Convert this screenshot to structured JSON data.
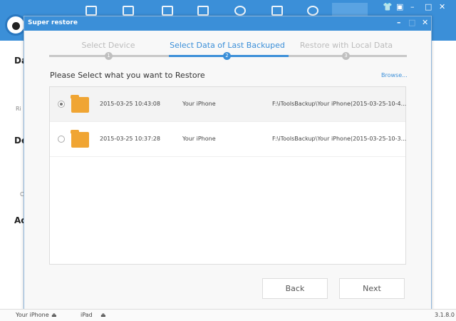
{
  "app": {
    "background_fragments": [
      "Da",
      "Ri",
      "De",
      "C",
      "Ac"
    ],
    "version": "3.1.8.0",
    "status_devices": [
      {
        "name": "Your iPhone"
      },
      {
        "name": "iPad"
      }
    ]
  },
  "dialog": {
    "title": "Super restore",
    "steps": [
      {
        "number": "1",
        "label": "Select Device",
        "active": false
      },
      {
        "number": "2",
        "label": "Select Data of Last Backuped",
        "active": true
      },
      {
        "number": "3",
        "label": "Restore with Local Data",
        "active": false
      }
    ],
    "prompt": "Please Select what you want to Restore",
    "browse_label": "Browse...",
    "backups": [
      {
        "selected": true,
        "date": "2015-03-25 10:43:08",
        "device": "Your iPhone",
        "path": "F:\\iToolsBackup\\Your iPhone(2015-03-25-10-4..."
      },
      {
        "selected": false,
        "date": "2015-03-25 10:37:28",
        "device": "Your iPhone",
        "path": "F:\\iToolsBackup\\Your iPhone(2015-03-25-10-3..."
      }
    ],
    "back_label": "Back",
    "next_label": "Next"
  },
  "colors": {
    "accent": "#3b8fd8",
    "folder": "#f0a533"
  }
}
